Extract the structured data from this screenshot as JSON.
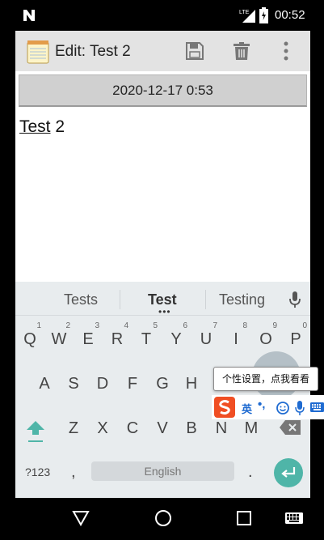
{
  "status_bar": {
    "time": "00:52",
    "network": "LTE"
  },
  "toolbar": {
    "title": "Edit: Test 2"
  },
  "date_button": {
    "label": "2020-12-17 0:53"
  },
  "note": {
    "word1": "Test",
    "word2": " 2"
  },
  "keyboard": {
    "suggestions": [
      "Tests",
      "Test",
      "Testing"
    ],
    "row1": [
      {
        "key": "Q",
        "hint": "1"
      },
      {
        "key": "W",
        "hint": "2"
      },
      {
        "key": "E",
        "hint": "3"
      },
      {
        "key": "R",
        "hint": "4"
      },
      {
        "key": "T",
        "hint": "5"
      },
      {
        "key": "Y",
        "hint": "6"
      },
      {
        "key": "U",
        "hint": "7"
      },
      {
        "key": "I",
        "hint": "8"
      },
      {
        "key": "O",
        "hint": "9"
      },
      {
        "key": "P",
        "hint": "0"
      }
    ],
    "row2": [
      "A",
      "S",
      "D",
      "F",
      "G",
      "H"
    ],
    "row3": [
      "Z",
      "X",
      "C",
      "V",
      "B",
      "N",
      "M"
    ],
    "symbols_label": "?123",
    "comma": ",",
    "space_label": "English",
    "period": "."
  },
  "ime_popup": {
    "tooltip": "个性设置，点我看看",
    "lang": "英",
    "punct": "•,"
  },
  "colors": {
    "accent": "#4fb5a8",
    "toolbar_bg": "#e3e3e3",
    "ime_blue": "#1f6bd1"
  },
  "icons": [
    "n-icon",
    "lte-signal-icon",
    "battery-icon",
    "notepad-app-icon",
    "save-icon",
    "delete-icon",
    "more-vert-icon",
    "mic-icon",
    "shift-icon",
    "backspace-icon",
    "enter-icon",
    "sogou-logo-icon",
    "emoji-icon",
    "keyboard-icon",
    "back-icon",
    "home-icon",
    "recent-apps-icon"
  ]
}
